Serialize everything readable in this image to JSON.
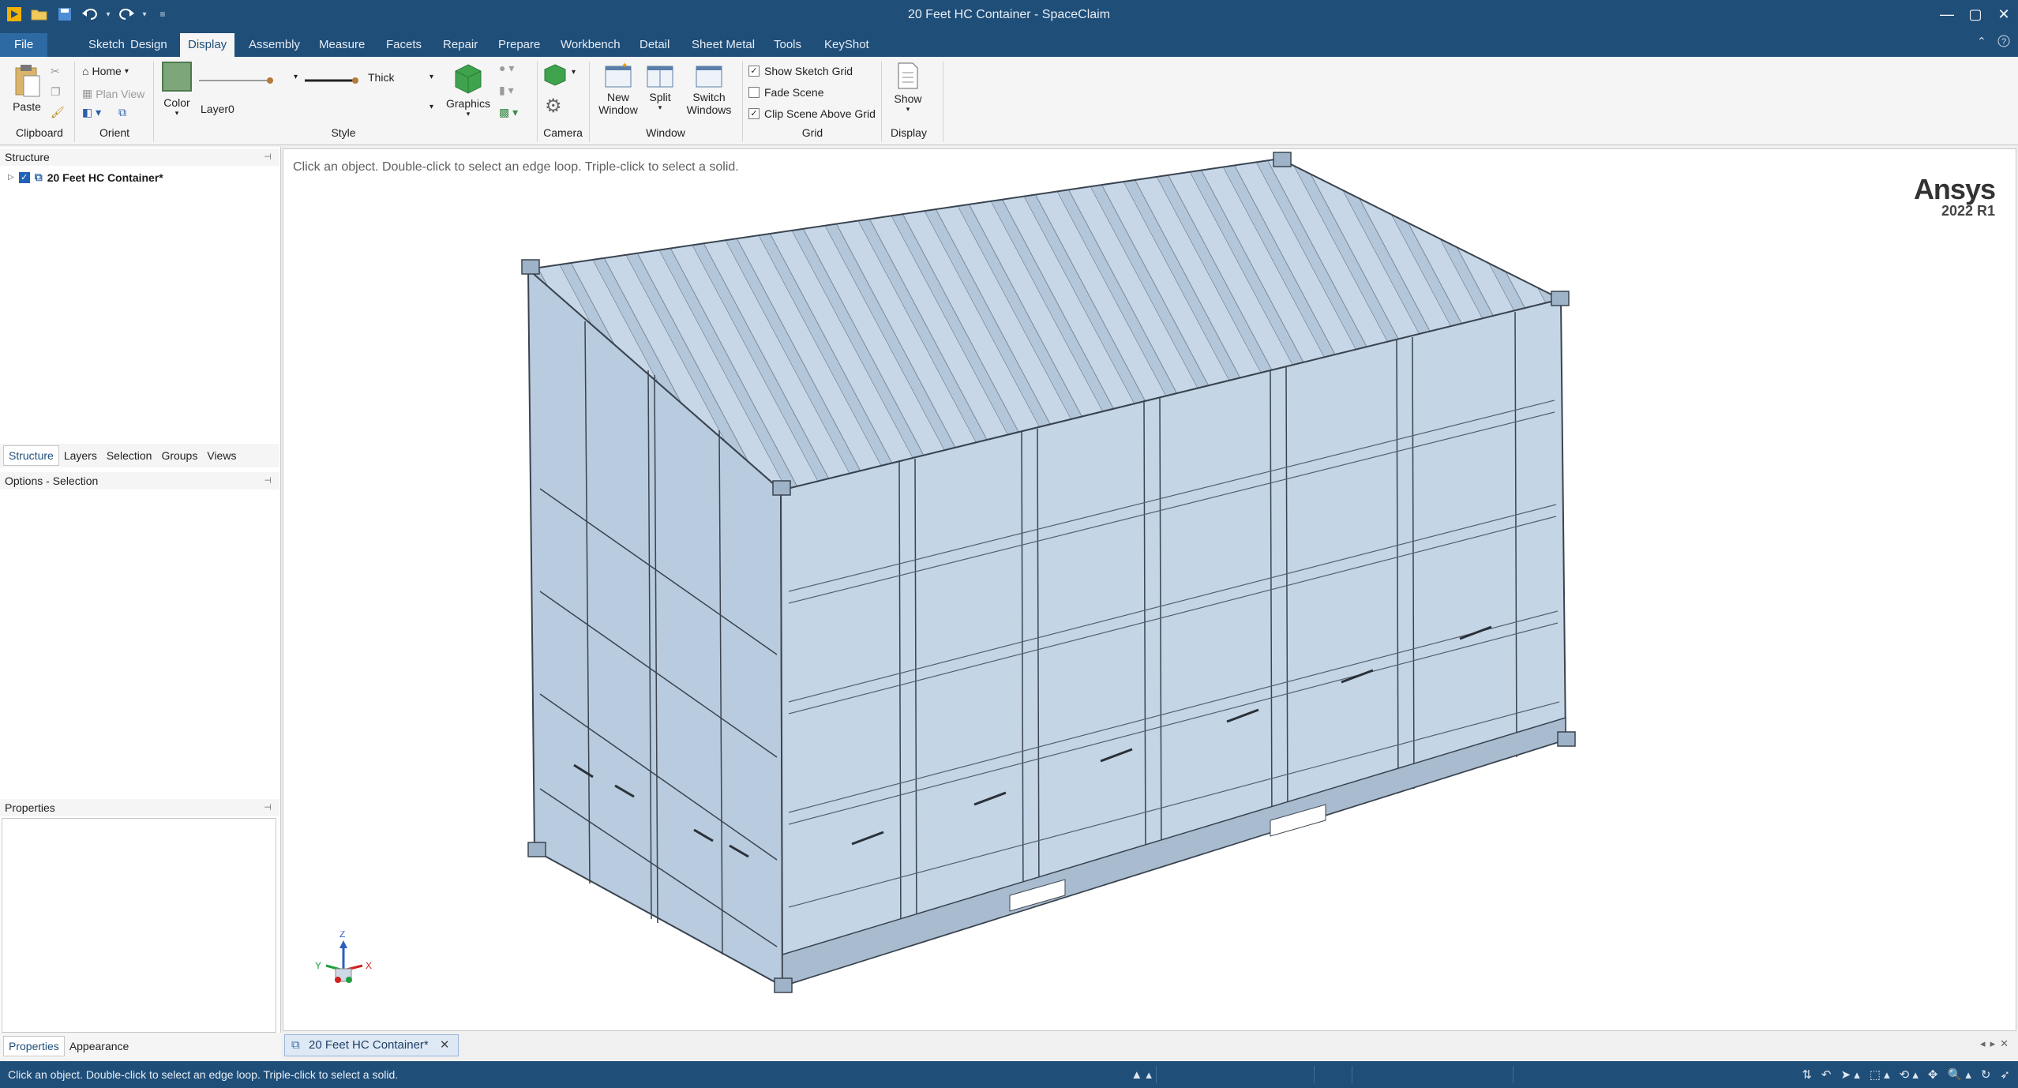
{
  "window": {
    "title": "20 Feet HC Container - SpaceClaim",
    "controls": {
      "minimize": "—",
      "maximize": "▢",
      "close": "✕"
    }
  },
  "quick_access": [
    "app-icon",
    "open-icon",
    "save-icon",
    "undo-icon",
    "redo-icon",
    "customize-icon"
  ],
  "menu": {
    "tabs": [
      "File",
      "Sketch",
      "Design",
      "Display",
      "Assembly",
      "Measure",
      "Facets",
      "Repair",
      "Prepare",
      "Workbench",
      "Detail",
      "Sheet Metal",
      "Tools",
      "KeyShot"
    ],
    "active": "Display"
  },
  "ribbon": {
    "clipboard": {
      "paste": "Paste",
      "label": "Clipboard"
    },
    "orient": {
      "home": "Home",
      "plan_view": "Plan View",
      "label": "Orient"
    },
    "style": {
      "color": "Color",
      "layer": "Layer0",
      "line_weight": "Thick",
      "graphics": "Graphics",
      "label": "Style"
    },
    "camera": {
      "label": "Camera"
    },
    "window": {
      "new_window": [
        "New",
        "Window"
      ],
      "split": "Split",
      "switch_windows": [
        "Switch",
        "Windows"
      ],
      "label": "Window"
    },
    "grid": {
      "show_sketch_grid": {
        "label": "Show Sketch Grid",
        "checked": true
      },
      "fade_scene": {
        "label": "Fade Scene",
        "checked": false
      },
      "clip_scene": {
        "label": "Clip Scene Above Grid",
        "checked": true
      },
      "label": "Grid"
    },
    "display": {
      "show": "Show",
      "label": "Display"
    }
  },
  "structure": {
    "header": "Structure",
    "root_item": "20 Feet HC Container*",
    "tabs": [
      "Structure",
      "Layers",
      "Selection",
      "Groups",
      "Views"
    ],
    "active_tab": "Structure"
  },
  "options": {
    "header": "Options - Selection"
  },
  "properties": {
    "header": "Properties",
    "tabs": [
      "Properties",
      "Appearance"
    ],
    "active_tab": "Properties"
  },
  "viewport": {
    "hint": "Click an object. Double-click to select an edge loop. Triple-click to select a solid.",
    "brand_name": "Ansys",
    "brand_version": "2022 R1",
    "triad": {
      "z": "Z",
      "y": "Y",
      "x": "X"
    }
  },
  "document_tab": {
    "label": "20 Feet HC Container*",
    "close": "✕"
  },
  "status_bar": {
    "message": "Click an object. Double-click to select an edge loop. Triple-click to select a solid."
  },
  "colors": {
    "title_bar": "#1f4e79",
    "model_fill": "#c2d3e4",
    "model_edge": "#3a4450"
  }
}
